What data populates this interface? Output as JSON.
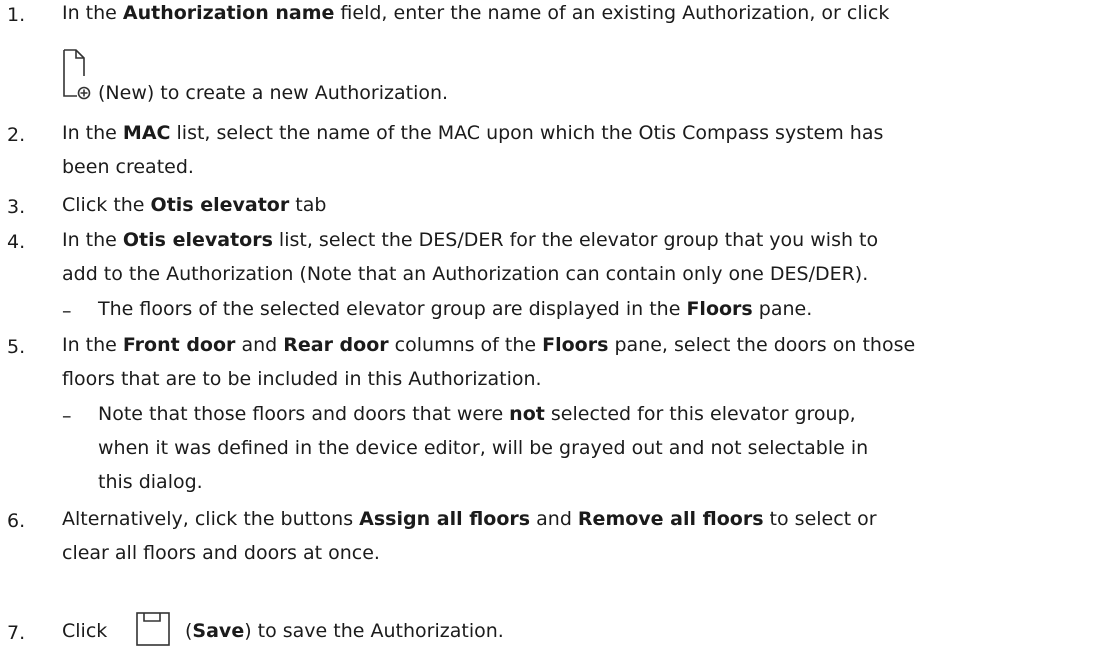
{
  "steps": [
    {
      "number": "1.",
      "line1": {
        "pre": "In the ",
        "b1": "Authorization name",
        "post": " field, enter the name of an existing Authorization, or click"
      },
      "line2": "(New) to create a new Authorization.",
      "icon": "new-document-icon"
    },
    {
      "number": "2.",
      "line1": {
        "pre": "In the ",
        "b1": "MAC",
        "post": " list, select the name of the MAC upon which the Otis Compass system has"
      },
      "line2": "been created."
    },
    {
      "number": "3.",
      "line1": {
        "pre": "Click the ",
        "b1": "Otis elevator",
        "post": " tab"
      }
    },
    {
      "number": "4.",
      "line1": {
        "pre": "In the ",
        "b1": "Otis elevators",
        "post": " list, select the DES/DER for the elevator group that you wish to"
      },
      "line2": "add to the Authorization (Note that an Authorization can contain only one DES/DER).",
      "sub": {
        "dash": "–",
        "pre": "The floors of the selected elevator group are displayed in the ",
        "b1": "Floors",
        "post": " pane."
      }
    },
    {
      "number": "5.",
      "line1": {
        "pre": "In the ",
        "b1": "Front door",
        "mid1": " and ",
        "b2": "Rear door",
        "mid2": " columns of the ",
        "b3": "Floors",
        "post": " pane, select the doors on those"
      },
      "line2": "floors that are to be included in this Authorization.",
      "sub": {
        "dash": "–",
        "pre": "Note that those floors and doors that were ",
        "b1": "not",
        "post": " selected for this elevator group,",
        "line2": "when it was defined in the device editor, will be grayed out and not selectable in",
        "line3": "this dialog."
      }
    },
    {
      "number": "6.",
      "line1": {
        "pre": "Alternatively, click the buttons ",
        "b1": "Assign all floors",
        "mid1": " and ",
        "b2": "Remove all floors",
        "post": " to select or"
      },
      "line2": "clear all floors and doors at once."
    },
    {
      "number": "7.",
      "line1": {
        "pre": "Click",
        "paren_open": " (",
        "b1": "Save",
        "post": ") to save the Authorization."
      },
      "icon": "save-icon"
    }
  ]
}
